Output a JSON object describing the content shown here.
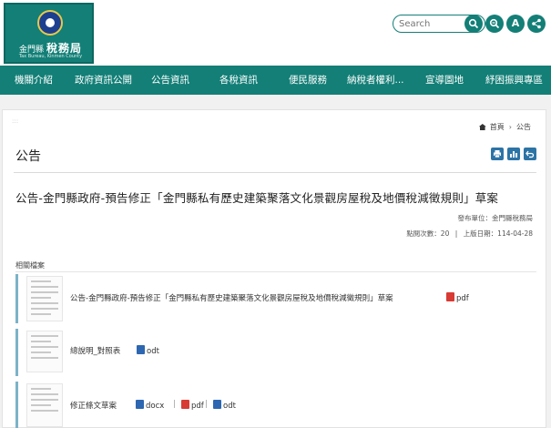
{
  "site": {
    "logo_name_small": "金門縣",
    "logo_name_big": "稅務局",
    "logo_en": "Tax Bureau, Kinmen County"
  },
  "search": {
    "placeholder": "Search"
  },
  "header_buttons": {
    "font_size_label": "A"
  },
  "nav": [
    "機關介紹",
    "政府資訊公開",
    "公告資訊",
    "各稅資訊",
    "便民服務",
    "納稅者權利...",
    "宣導園地",
    "紓困振興專區"
  ],
  "breadcrumb": {
    "home": "首頁",
    "separator": "›",
    "current": "公告"
  },
  "page": {
    "title": "公告",
    "headline": "公告-金門縣政府-預告修正「金門縣私有歷史建築聚落文化景觀房屋稅及地價稅減徵規則」草案",
    "publisher": "發布單位：金門縣稅務局",
    "views": "點閱次數：20",
    "meta_sep": "|",
    "updated": "上版日期：114-04-28"
  },
  "related": {
    "label": "相關檔案",
    "files": [
      {
        "title": "公告-金門縣政府-預告修正「金門縣私有歷史建築聚落文化景觀房屋稅及地價稅減徵規則」草案",
        "formats": [
          "pdf"
        ]
      },
      {
        "title": "總說明_對照表",
        "formats": [
          "odt"
        ]
      },
      {
        "title": "修正條文草案",
        "formats": [
          "docx",
          "pdf",
          "odt"
        ]
      }
    ],
    "format_sep": "|"
  },
  "colors": {
    "brand": "#137f77",
    "tool_blue": "#2c74a6",
    "pdf_red": "#d83a34",
    "doc_blue": "#2d67b1"
  },
  "icons": {
    "search": "search-icon",
    "zoom": "zoom-icon",
    "share": "share-icon",
    "home": "home-icon",
    "print": "print-icon",
    "chart": "chart-icon",
    "back": "back-icon"
  }
}
